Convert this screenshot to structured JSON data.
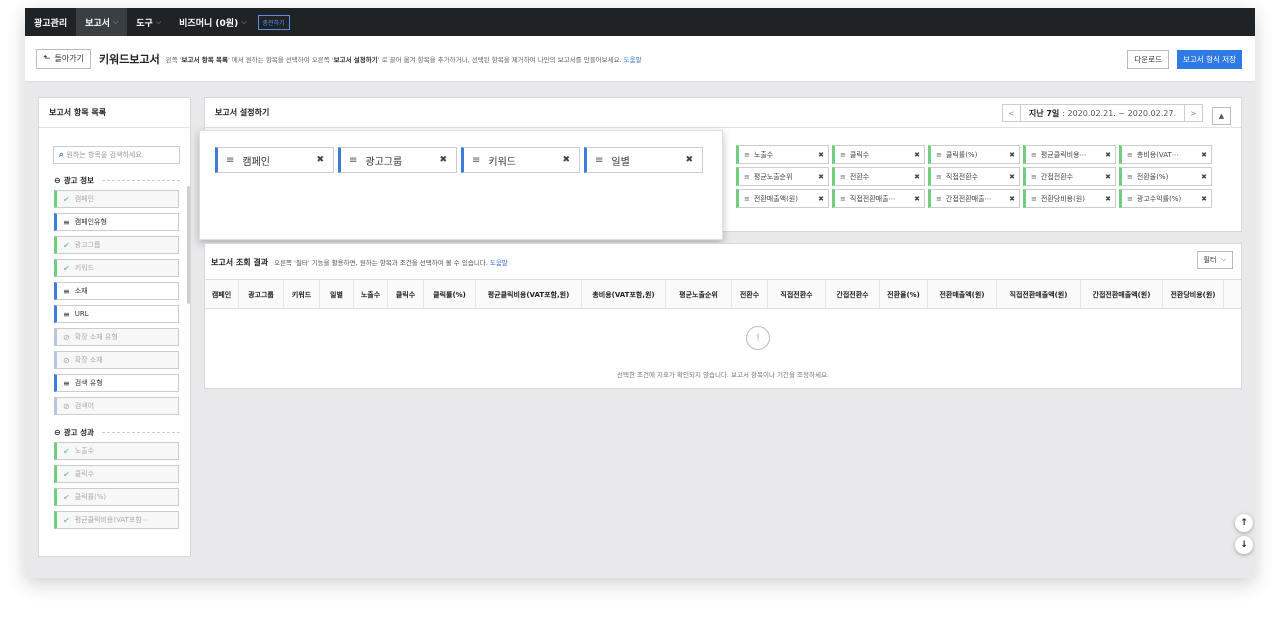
{
  "nav": {
    "items": [
      {
        "label": "광고관리",
        "chevron": false,
        "active": false
      },
      {
        "label": "보고서",
        "chevron": true,
        "active": true
      },
      {
        "label": "도구",
        "chevron": true,
        "active": false
      },
      {
        "label": "비즈머니 (0원)",
        "chevron": true,
        "active": false
      }
    ],
    "charge_label": "충전하기"
  },
  "subheader": {
    "back_label": "돌아가기",
    "title": "키워드보고서",
    "desc_1": "왼쪽 '",
    "desc_bold_1": "보고서 항목 목록",
    "desc_2": "' 에서 원하는 항목을 선택하여 오른쪽 '",
    "desc_bold_2": "보고서 설정하기",
    "desc_3": "' 로 끌어 옮겨 항목을 추가하거나, 선택된 항목을 제거하여 나만의 보고서를 만들어보세요.",
    "help_label": "도움말",
    "download_label": "다운로드",
    "save_label": "보고서 형식 저장"
  },
  "left_panel": {
    "title": "보고서 항목 목록",
    "search_placeholder": "원하는 항목을 검색하세요.",
    "sections": [
      {
        "title": "광고 정보",
        "items": [
          {
            "label": "캠페인",
            "state": "green",
            "icon": "check-icon"
          },
          {
            "label": "캠페인유형",
            "state": "blue",
            "icon": "drag-handle-icon"
          },
          {
            "label": "광고그룹",
            "state": "green",
            "icon": "check-icon"
          },
          {
            "label": "키워드",
            "state": "green",
            "icon": "check-icon"
          },
          {
            "label": "소재",
            "state": "blue",
            "icon": "drag-handle-icon"
          },
          {
            "label": "URL",
            "state": "blue",
            "icon": "drag-handle-icon"
          },
          {
            "label": "확장 소재 유형",
            "state": "grey",
            "icon": "disabled-icon"
          },
          {
            "label": "확장 소재",
            "state": "grey",
            "icon": "disabled-icon"
          },
          {
            "label": "검색 유형",
            "state": "blue",
            "icon": "drag-handle-icon"
          },
          {
            "label": "검색어",
            "state": "grey",
            "icon": "disabled-icon"
          }
        ]
      },
      {
        "title": "광고 성과",
        "items": [
          {
            "label": "노출수",
            "state": "green",
            "icon": "check-icon"
          },
          {
            "label": "클릭수",
            "state": "green",
            "icon": "check-icon"
          },
          {
            "label": "클릭률(%)",
            "state": "green",
            "icon": "check-icon"
          },
          {
            "label": "평균클릭비용(VAT포함⋯",
            "state": "green",
            "icon": "check-icon"
          }
        ]
      }
    ]
  },
  "settings": {
    "title": "보고서 설정하기",
    "date_label": "지난 7일",
    "date_range": ": 2020.02.21. ~ 2020.02.27.",
    "dimensions": [
      "캠페인",
      "광고그룹",
      "키워드",
      "일별"
    ],
    "metrics": [
      "노출수",
      "클릭수",
      "클릭률(%)",
      "평균클릭비용⋯",
      "총비용(VAT⋯",
      "평균노출순위",
      "전환수",
      "직접전환수",
      "간접전환수",
      "전환율(%)",
      "전환매출액(원)",
      "직접전환매출⋯",
      "간접전환매출⋯",
      "전환당비용(원)",
      "광고수익률(%)"
    ]
  },
  "results": {
    "title": "보고서 조회 결과",
    "desc": "오른쪽 '필터' 기능을 활용하면, 원하는 항목과 조건을 선택하여 볼 수 있습니다.",
    "help_label": "도움말",
    "filter_label": "필터",
    "columns": [
      "캠페인",
      "광고그룹",
      "키워드",
      "일별",
      "노출수",
      "클릭수",
      "클릭률(%)",
      "평균클릭비용(VAT포함,원)",
      "총비용(VAT포함,원)",
      "평균노출순위",
      "전환수",
      "직접전환수",
      "간접전환수",
      "전환율(%)",
      "전환매출액(원)",
      "직접전환매출액(원)",
      "간접전환매출액(원)",
      "전환당비용(원)"
    ],
    "empty_message": "선택한 조건에 지표가 확인되지 않습니다. 보고서 항목이나 기간을 조정하세요."
  },
  "colors": {
    "nav_bg": "#1f2326",
    "primary": "#2f7ae5",
    "dimension_accent": "#3b7ddd",
    "metric_accent": "#6fcf7f"
  }
}
